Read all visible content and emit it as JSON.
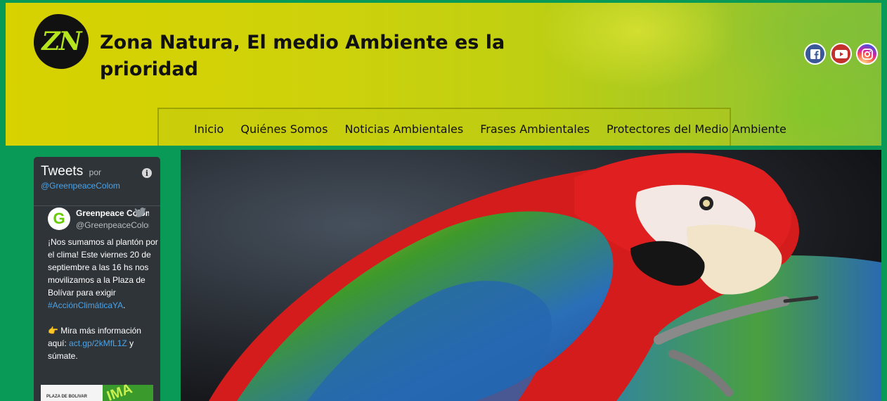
{
  "header": {
    "logo_text": "ZN",
    "site_title": "Zona Natura, El medio Ambiente es la prioridad",
    "social": [
      {
        "icon": "facebook-icon",
        "color": "#3b5998"
      },
      {
        "icon": "youtube-icon",
        "color": "#c4302b"
      },
      {
        "icon": "instagram-icon",
        "color": "#d6249f"
      }
    ]
  },
  "nav": {
    "items": [
      "Inicio",
      "Quiénes Somos",
      "Noticias Ambientales",
      "Frases Ambientales",
      "Protectores del Medio Ambiente"
    ]
  },
  "tweets": {
    "title": "Tweets",
    "by": "por",
    "handle": "@GreenpeaceColom",
    "post": {
      "avatar_letter": "G",
      "name": "Greenpeace Colom",
      "user_handle": "@GreenpeaceColom",
      "text_1": "¡Nos sumamos al plantón por el clima! Este viernes 20 de septiembre a las 16 hs nos movilizamos a la Plaza de Bolívar para exigir ",
      "hashtag": "#AcciónClimáticaYA",
      "text_2": ".",
      "text_3": "👉 Mira más información aquí: ",
      "link": "act.gp/2kMfL1Z",
      "text_4": " y súmate.",
      "media_label": "PLAZA DE BOLIVAR",
      "media_text": "IMA"
    }
  },
  "colors": {
    "page_bg": "#0a9a58",
    "header_yellow": "#d7d200",
    "widget_bg": "#2f3439",
    "link_blue": "#4aa3e8"
  }
}
